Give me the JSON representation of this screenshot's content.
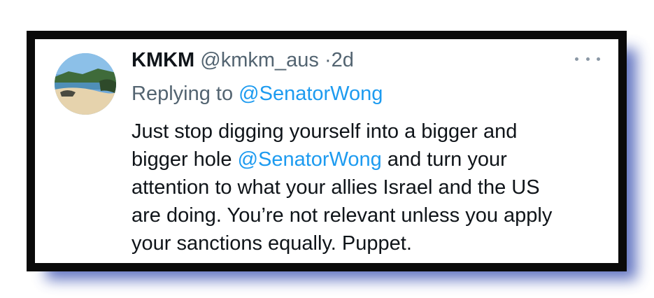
{
  "tweet": {
    "display_name": "KMKM",
    "handle": "@kmkm_aus",
    "separator": "·",
    "time": "2d",
    "replying_prefix": "Replying to ",
    "replying_mention": "@SenatorWong",
    "body": {
      "line1": "Just stop digging yourself into a bigger and",
      "line2_before": "bigger hole ",
      "line2_mention": "@SenatorWong",
      "line2_after": " and turn your",
      "line3": "attention to what your allies Israel and the US",
      "line4": "are doing. You’re not relevant unless you apply",
      "line5": "your sanctions equally. Puppet."
    },
    "more_icon": "more-horizontal-icon",
    "mention_color": "#1d9bf0",
    "frame_color": "#0a0a0a",
    "shadow_color": "#4a5fb8"
  }
}
